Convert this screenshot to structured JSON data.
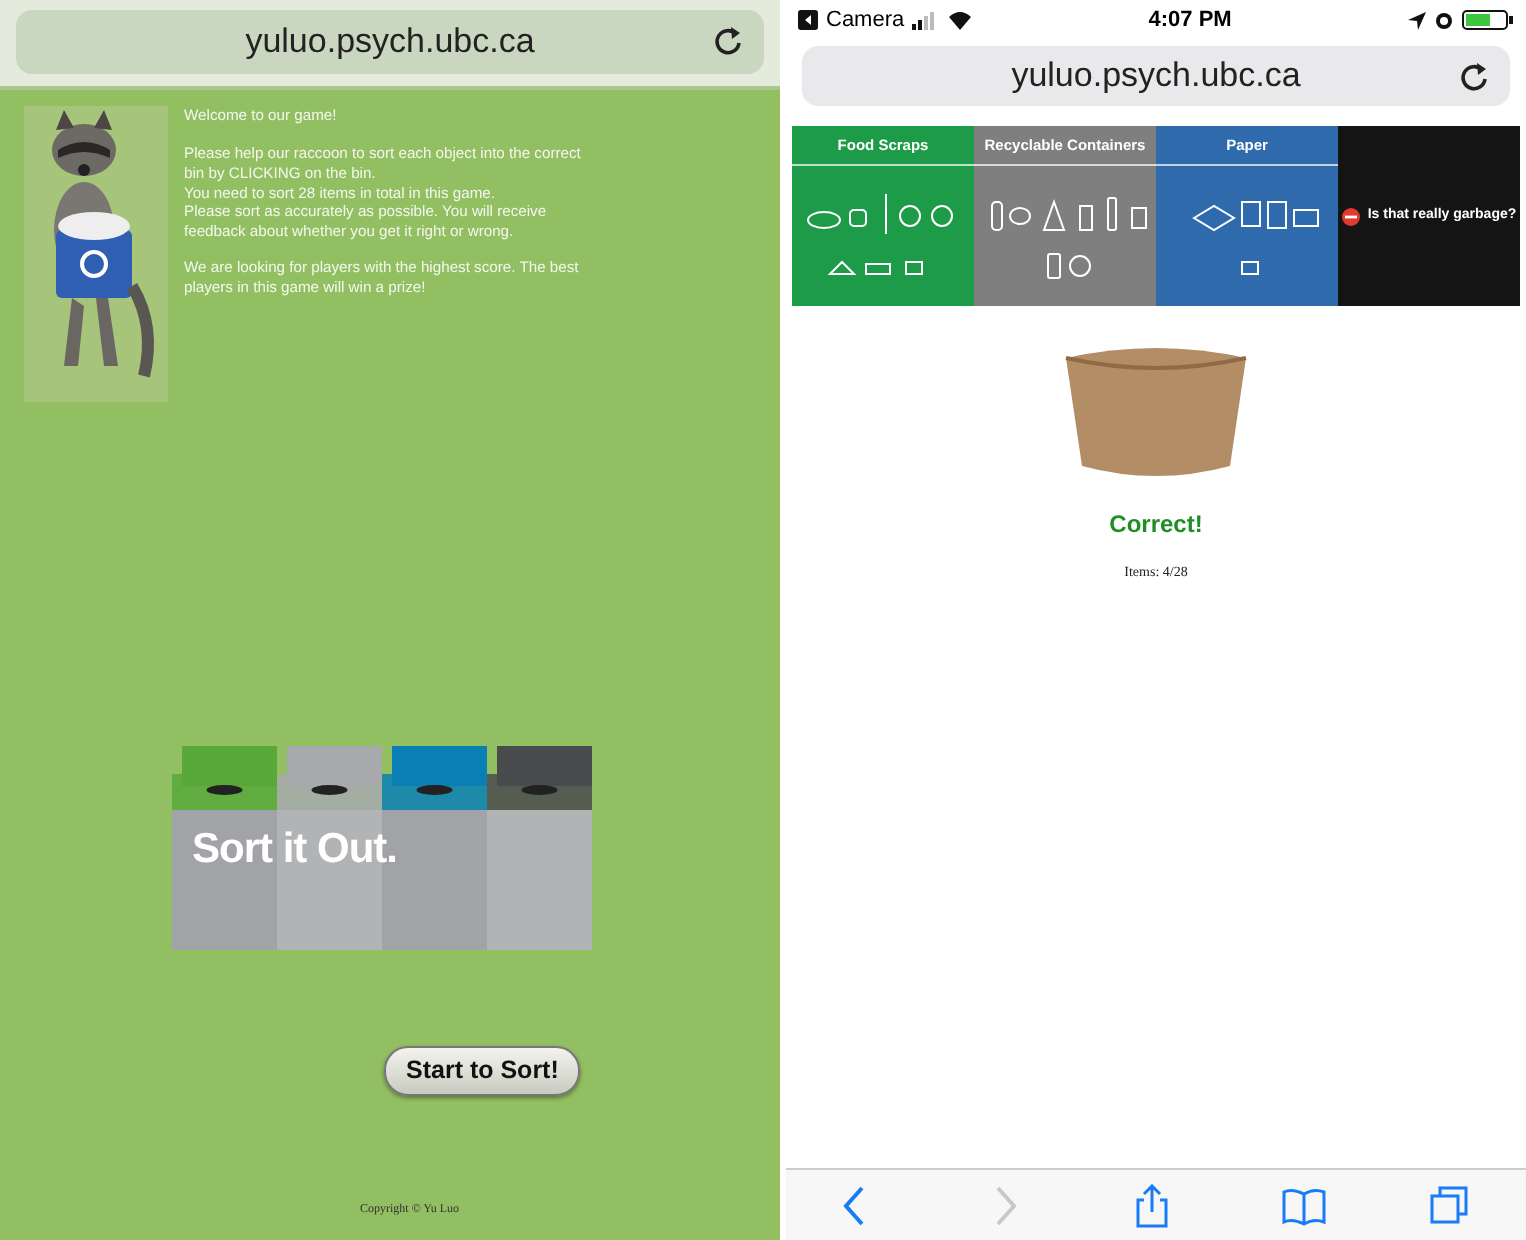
{
  "left_screen": {
    "address_bar": {
      "url": "yuluo.psych.ubc.ca"
    },
    "intro": {
      "title": "Welcome to our game!",
      "paragraphs": [
        [
          "Please help our raccoon to sort each object into the correct bin by CLICKING on the bin.",
          "You need to sort 28 items in total in this game.",
          "Please sort as accurately as possible. You will receive feedback about whether you get it right or wrong."
        ],
        [
          "We are looking for players with the highest score. The best players in this game will win a prize!"
        ]
      ]
    },
    "logo": {
      "text": "Sort it Out.",
      "bins": [
        {
          "color": "#58a83a"
        },
        {
          "color": "#a7a9ac"
        },
        {
          "color": "#0a7fb5"
        },
        {
          "color": "#4a4b4d"
        }
      ]
    },
    "start_button": "Start to Sort!",
    "copyright": "Copyright © Yu Luo"
  },
  "right_screen": {
    "status_bar": {
      "back_app": "Camera",
      "time": "4:07 PM"
    },
    "address_bar": {
      "url": "yuluo.psych.ubc.ca"
    },
    "bins": [
      {
        "kind": "compost",
        "label": "Food Scraps",
        "color": "#1e9b48"
      },
      {
        "kind": "containers",
        "label": "Recyclable Containers",
        "color": "#7f7f7f"
      },
      {
        "kind": "paper",
        "label": "Paper",
        "color": "#2f6aad"
      },
      {
        "kind": "garbage",
        "label": "Is that really garbage?",
        "color": "#141414"
      }
    ],
    "feedback": "Correct!",
    "progress": "Items: 4/28",
    "toolbar": [
      {
        "kind": "back",
        "disabled": false
      },
      {
        "kind": "forward",
        "disabled": true
      },
      {
        "kind": "share",
        "disabled": false
      },
      {
        "kind": "bookmarks",
        "disabled": false
      },
      {
        "kind": "tabs",
        "disabled": false
      }
    ]
  }
}
